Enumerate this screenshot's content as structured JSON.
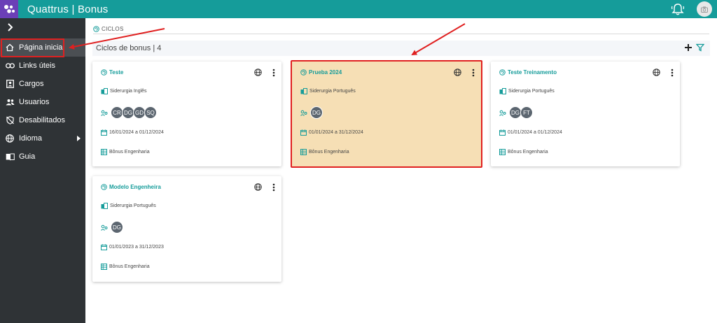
{
  "app": {
    "title": "Quattrus | Bonus"
  },
  "sidebar": {
    "items": [
      {
        "label": "Página inicial",
        "icon": "home-icon"
      },
      {
        "label": "Links úteis",
        "icon": "link-icon"
      },
      {
        "label": "Cargos",
        "icon": "badge-icon"
      },
      {
        "label": "Usuarios",
        "icon": "users-icon"
      },
      {
        "label": "Desabilitados",
        "icon": "shield-off-icon"
      },
      {
        "label": "Idioma",
        "icon": "globe-icon"
      },
      {
        "label": "Guia",
        "icon": "book-icon"
      }
    ]
  },
  "breadcrumb": {
    "label": "CICLOS"
  },
  "section": {
    "title": "Ciclos de bonus | 4"
  },
  "cards": [
    {
      "title": "Teste",
      "company": "Siderurgia Inglês",
      "participants": [
        "CR",
        "DG",
        "GD",
        "SQ"
      ],
      "period": "16/01/2024 a 01/12/2024",
      "bonus": "Bônus Engenharia"
    },
    {
      "title": "Prueba 2024",
      "company": "Siderurgia Português",
      "participants": [
        "DG"
      ],
      "period": "01/01/2024 a 31/12/2024",
      "bonus": "Bônus Engenharia"
    },
    {
      "title": "Teste Treinamento",
      "company": "Siderurgia Português",
      "participants": [
        "DG",
        "FT"
      ],
      "period": "01/01/2024 a 01/12/2024",
      "bonus": "Bônus Engenharia"
    },
    {
      "title": "Modelo Engenheira",
      "company": "Siderurgia Português",
      "participants": [
        "DG"
      ],
      "period": "01/01/2023 a 31/12/2023",
      "bonus": "Bônus Engenharia"
    }
  ],
  "colors": {
    "brand": "#159c9a",
    "logo": "#6b3fb7",
    "sidebar": "#2f3336",
    "selected_card": "#f6dfb5",
    "annotation": "#e02020"
  }
}
